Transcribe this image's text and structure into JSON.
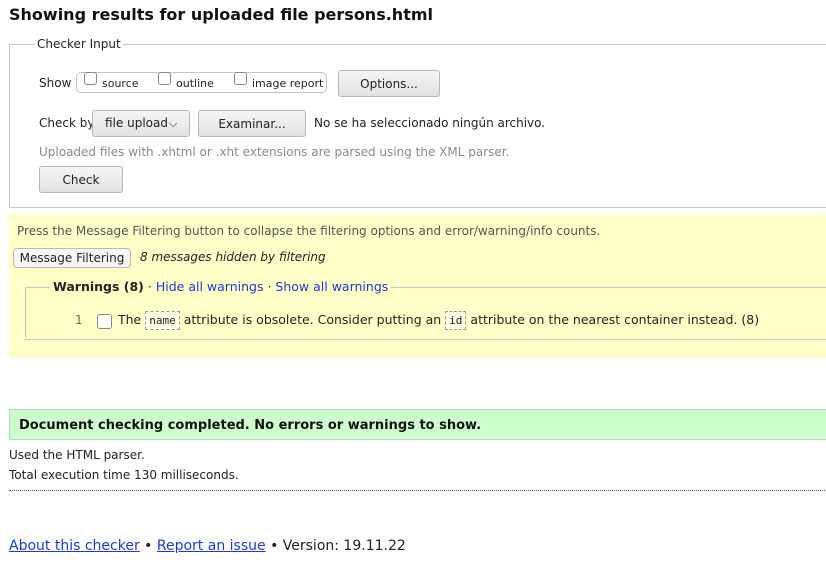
{
  "page_title": "Showing results for uploaded file persons.html",
  "checker_input": {
    "legend": "Checker Input",
    "show_label": "Show",
    "options": [
      {
        "label": "source",
        "checked": false
      },
      {
        "label": "outline",
        "checked": false
      },
      {
        "label": "image report",
        "checked": false
      }
    ],
    "options_button": "Options...",
    "check_by_label": "Check by",
    "check_by_value": "file upload",
    "browse_button": "Examinar...",
    "no_file_text": "No se ha seleccionado ningún archivo.",
    "xml_hint": "Uploaded files with .xhtml or .xht extensions are parsed using the XML parser.",
    "check_button": "Check"
  },
  "filtering": {
    "instructions": "Press the Message Filtering button to collapse the filtering options and error/warning/info counts.",
    "button_label": "Message Filtering",
    "hidden_count_text": "8 messages hidden by filtering",
    "warnings_heading": "Warnings (8)",
    "separator": "·",
    "hide_all": "Hide all warnings",
    "show_all": "Show all warnings",
    "rows": [
      {
        "num": "1",
        "text_before": "The",
        "code1": "name",
        "text_middle": "attribute is obsolete. Consider putting an",
        "code2": "id",
        "text_after": "attribute on the nearest container instead. (8)"
      }
    ]
  },
  "result": {
    "message": "Document checking completed. No errors or warnings to show.",
    "parser_note": "Used the HTML parser.",
    "execution_time": "Total execution time 130 milliseconds."
  },
  "footer": {
    "about_link": "About this checker",
    "bullet": "•",
    "report_link": "Report an issue",
    "version_text": "Version: 19.11.22"
  },
  "colors": {
    "filter_panel_bg": "#ffffc8",
    "success_bg": "#ccffcc",
    "link": "#1a3cc8"
  }
}
